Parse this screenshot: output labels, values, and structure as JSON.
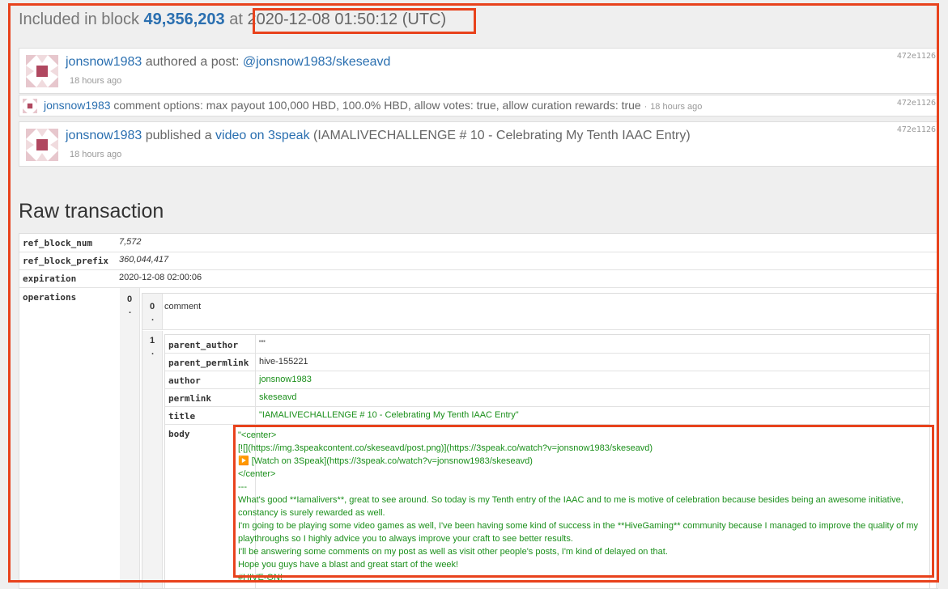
{
  "block": {
    "prefix": "Included in block",
    "number": "49,356,203",
    "at": "at",
    "date": "2020-12-08 01:50:12 (UTC)"
  },
  "ops": [
    {
      "user": "jonsnow1983",
      "action": "authored a post:",
      "link": "@jonsnow1983/skeseavd",
      "time": "18 hours ago",
      "hash": "472e1126"
    },
    {
      "user": "jonsnow1983",
      "text": "comment options: max payout 100,000 HBD, 100.0% HBD, allow votes: true, allow curation rewards: true",
      "sep": "·",
      "time": "18 hours ago",
      "hash": "472e1126"
    },
    {
      "user": "jonsnow1983",
      "action": "published a",
      "link": "video on 3speak",
      "title": "(IAMALIVECHALLENGE # 10 - Celebrating My Tenth IAAC Entry)",
      "time": "18 hours ago",
      "hash": "472e1126"
    }
  ],
  "raw": {
    "title": "Raw transaction",
    "ref_block_num_key": "ref_block_num",
    "ref_block_num": "7,572",
    "ref_block_prefix_key": "ref_block_prefix",
    "ref_block_prefix": "360,044,417",
    "expiration_key": "expiration",
    "expiration": "2020-12-08 02:00:06",
    "operations_key": "operations",
    "op_index": "0",
    "op_index_dot": ".",
    "sub0_index": "0",
    "sub0_value": "comment",
    "sub1_index": "1",
    "fields": {
      "parent_author_key": "parent_author",
      "parent_author": "\"\"",
      "parent_permlink_key": "parent_permlink",
      "parent_permlink": "hive-155221",
      "author_key": "author",
      "author": "jonsnow1983",
      "permlink_key": "permlink",
      "permlink": "skeseavd",
      "title_key": "title",
      "title": "\"IAMALIVECHALLENGE # 10 - Celebrating My Tenth IAAC Entry\"",
      "body_key": "body"
    },
    "body_lines": [
      "\"<center>",
      "[![](https://img.3speakcontent.co/skeseavd/post.png)](https://3speak.co/watch?v=jonsnow1983/skeseavd)",
      "▶️ [Watch on 3Speak](https://3speak.co/watch?v=jonsnow1983/skeseavd)",
      "</center>",
      "---",
      "What's good **Iamalivers**, great to see around. So today is my Tenth entry of the IAAC and to me is motive of celebration because besides being an awesome initiative, constancy is surely rewarded as well.",
      "I'm going to be playing some video games as well, I've been having some kind of success in the **HiveGaming** community because I managed to improve the quality of my playthroughs so I highly advice you to always improve your craft to see better results.",
      "I'll be answering some comments on my post as well as visit other people's posts, I'm kind of delayed on that.",
      "Hope you guys have a blast and great start of the week!",
      "#HIVE-ON!"
    ]
  }
}
